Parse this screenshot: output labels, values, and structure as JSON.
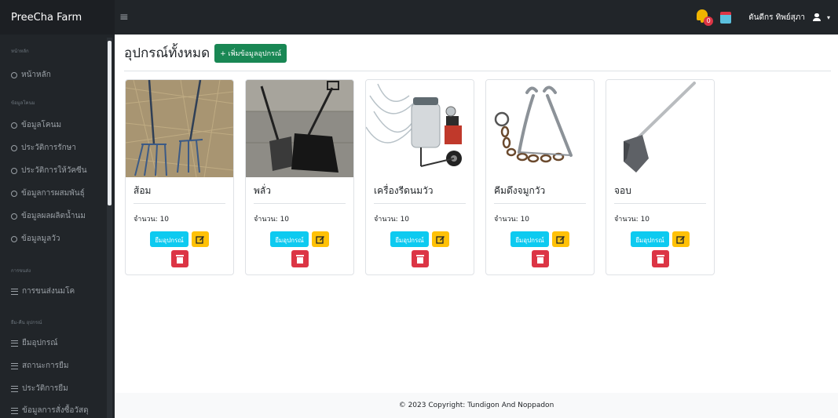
{
  "brand": "PreeCha Farm",
  "header": {
    "notification_count": "0",
    "user_name": "ดันดีกร ทิพย์สุภา"
  },
  "sidebar": {
    "sections": [
      {
        "heading": "หน้าหลัก",
        "items": [
          {
            "label": "หน้าหลัก",
            "icon": "dashboard-icon"
          }
        ]
      },
      {
        "heading": "ข้อมูลโคนม",
        "items": [
          {
            "label": "ข้อมูลโคนม",
            "icon": "circle-icon"
          },
          {
            "label": "ประวัติการรักษา",
            "icon": "circle-icon"
          },
          {
            "label": "ประวัติการให้วัคซีน",
            "icon": "circle-icon"
          },
          {
            "label": "ข้อมูลการผสมพันธุ์",
            "icon": "circle-icon"
          },
          {
            "label": "ข้อมูลผลผลิตน้ำนม",
            "icon": "circle-icon"
          },
          {
            "label": "ข้อมูลมูลวัว",
            "icon": "circle-icon"
          }
        ]
      },
      {
        "heading": "การขนส่ง",
        "items": [
          {
            "label": "การขนส่งนมโค",
            "icon": "list-icon"
          }
        ]
      },
      {
        "heading": "ยืม-คืน อุปกรณ์",
        "items": [
          {
            "label": "ยืมอุปกรณ์",
            "icon": "list-icon"
          },
          {
            "label": "สถานะการยืม",
            "icon": "list-icon"
          },
          {
            "label": "ประวัติการยืม",
            "icon": "list-icon"
          },
          {
            "label": "ข้อมูลการสั่งซื้อวัสดุ",
            "icon": "list-icon"
          }
        ]
      }
    ]
  },
  "main": {
    "title": "อุปกรณ์ทั้งหมด",
    "add_button": "+ เพิ่มข้อมูลอุปกรณ์",
    "borrow_label": "ยืมอุปกรณ์",
    "items": [
      {
        "name": "ส้อม",
        "quantity": "จำนวน: 10",
        "image": "pitchfork"
      },
      {
        "name": "พลั่ว",
        "quantity": "จำนวน: 10",
        "image": "shovel"
      },
      {
        "name": "เครื่องรีดนมวัว",
        "quantity": "จำนวน: 10",
        "image": "milking-machine"
      },
      {
        "name": "คีมดึงจมูกวัว",
        "quantity": "จำนวน: 10",
        "image": "nose-tongs"
      },
      {
        "name": "จอบ",
        "quantity": "จำนวน: 10",
        "image": "hoe"
      }
    ]
  },
  "footer": "© 2023 Copyright: Tundigon And Noppadon",
  "colors": {
    "navbar": "#212529",
    "add_button": "#198754",
    "borrow_button": "#0dcaf0",
    "edit_button": "#ffc107",
    "delete_button": "#dc3545"
  }
}
